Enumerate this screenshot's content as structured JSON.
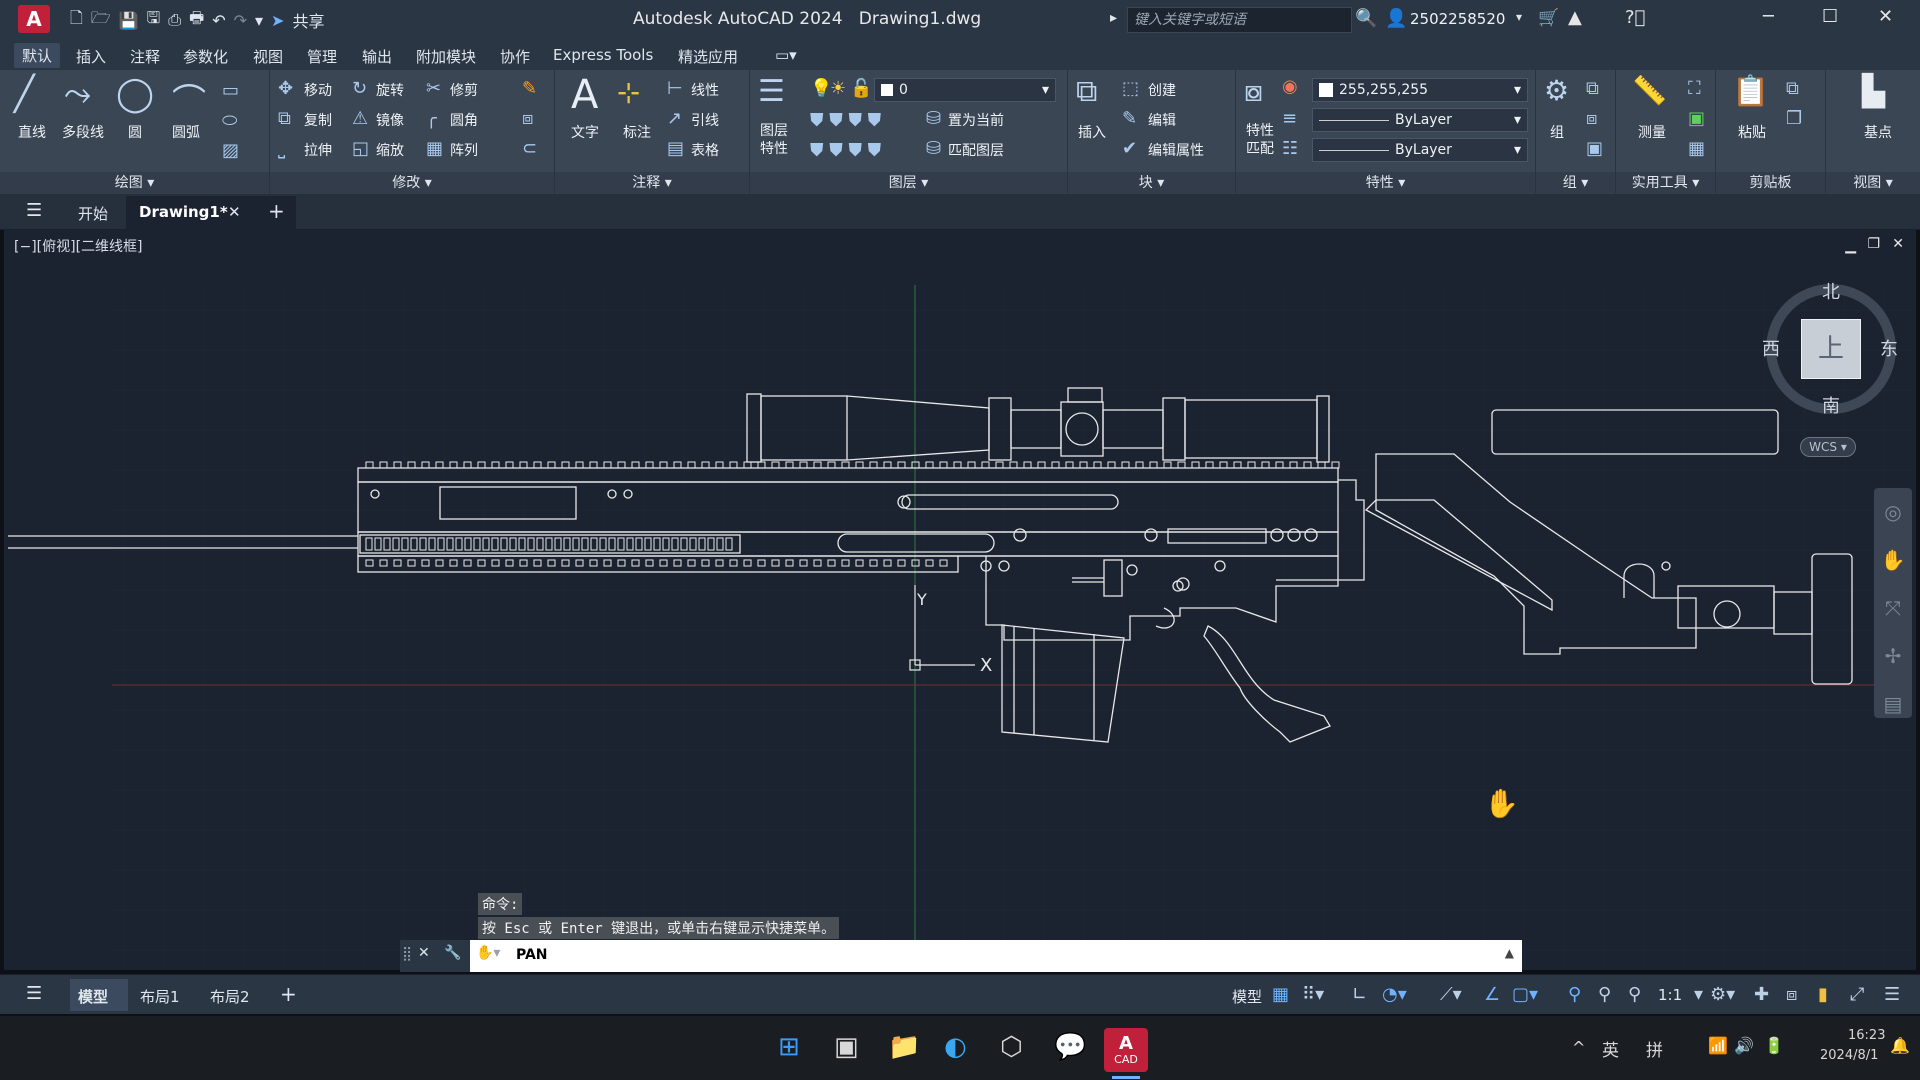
{
  "app": {
    "title": "Autodesk AutoCAD 2024",
    "document": "Drawing1.dwg",
    "logo_letter": "A",
    "share_label": "共享",
    "search_placeholder": "键入关键字或短语",
    "user": "2502258520"
  },
  "menu_tabs": [
    "默认",
    "插入",
    "注释",
    "参数化",
    "视图",
    "管理",
    "输出",
    "附加模块",
    "协作",
    "Express Tools",
    "精选应用"
  ],
  "ribbon": {
    "draw": {
      "title": "绘图",
      "items": [
        "直线",
        "多段线",
        "圆",
        "圆弧"
      ]
    },
    "modify": {
      "title": "修改",
      "items": [
        "移动",
        "旋转",
        "修剪",
        "复制",
        "镜像",
        "圆角",
        "拉伸",
        "缩放",
        "阵列"
      ]
    },
    "annotation": {
      "title": "注释",
      "items": [
        "文字",
        "标注",
        "线性",
        "引线",
        "表格"
      ]
    },
    "layers": {
      "title": "图层",
      "items": [
        "图层特性",
        "置为当前",
        "匹配图层"
      ],
      "current_layer": "0"
    },
    "block": {
      "title": "块",
      "items": [
        "插入",
        "创建",
        "编辑",
        "编辑属性"
      ]
    },
    "properties": {
      "title": "特性",
      "items": [
        "特性匹配"
      ],
      "color": "255,255,255",
      "linetype": "ByLayer",
      "lineweight": "ByLayer"
    },
    "groups": {
      "title": "组",
      "items": [
        "组"
      ]
    },
    "utilities": {
      "title": "实用工具",
      "items": [
        "测量"
      ]
    },
    "clipboard": {
      "title": "剪贴板",
      "items": [
        "粘贴"
      ]
    },
    "view": {
      "title": "视图",
      "items": [
        "基点"
      ]
    }
  },
  "doc_tabs": {
    "start": "开始",
    "active": "Drawing1*"
  },
  "viewport": {
    "label": "[−][俯视][二维线框]",
    "compass": {
      "north": "北",
      "south": "南",
      "east": "东",
      "west": "西",
      "top": "上"
    },
    "wcs": "WCS",
    "ucs_x": "X",
    "ucs_y": "Y"
  },
  "command": {
    "history": [
      "命令:",
      "按 Esc 或 Enter 键退出，或单击右键显示快捷菜单。"
    ],
    "current": "PAN"
  },
  "status_tabs": [
    "模型",
    "布局1",
    "布局2"
  ],
  "status": {
    "model_label": "模型",
    "scale": "1:1"
  },
  "taskbar": {
    "ime1": "英",
    "ime2": "拼",
    "time": "16:23",
    "date": "2024/8/1",
    "app_label": "CAD"
  },
  "colors": {
    "accent": "#c0203a",
    "canvas": "#1b2230",
    "ribbon": "#3b4655"
  }
}
